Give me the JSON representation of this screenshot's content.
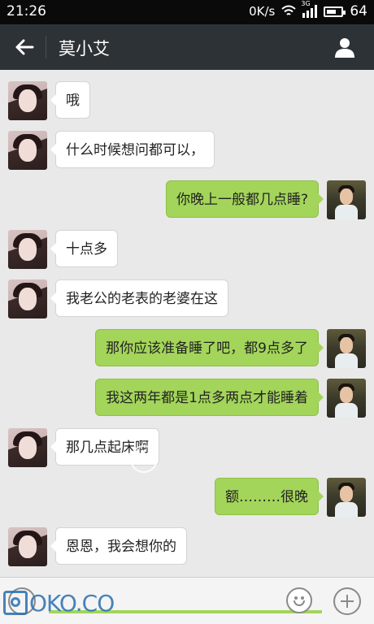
{
  "status_bar": {
    "time": "21:26",
    "network_speed": "0K/s",
    "signal_tag": "3G",
    "battery": "64",
    "battery_level": 0.64
  },
  "header": {
    "title": "莫小艾",
    "back_icon": "back-arrow-icon",
    "profile_icon": "person-icon"
  },
  "messages": [
    {
      "sender": "other",
      "text": "哦"
    },
    {
      "sender": "other",
      "text": "什么时候想问都可以，"
    },
    {
      "sender": "me",
      "text": "你晚上一般都几点睡?"
    },
    {
      "sender": "other",
      "text": "十点多"
    },
    {
      "sender": "other",
      "text": "我老公的老表的老婆在这"
    },
    {
      "sender": "me",
      "text": "那你应该准备睡了吧，都9点多了"
    },
    {
      "sender": "me",
      "text": "我这两年都是1点多两点才能睡着"
    },
    {
      "sender": "other",
      "text": "那几点起床啊"
    },
    {
      "sender": "me",
      "text": "额………很晚"
    },
    {
      "sender": "other",
      "text": "恩恩，我会想你的"
    }
  ],
  "input_bar": {
    "placeholder": "",
    "voice_icon": "voice-icon",
    "emoji_icon": "emoji-icon",
    "add_icon": "plus-icon"
  },
  "watermark": "OKO.CO",
  "colors": {
    "my_bubble": "#a3d55a",
    "their_bubble": "#ffffff",
    "titlebar": "#2d3236",
    "background": "#e9e9e9"
  }
}
